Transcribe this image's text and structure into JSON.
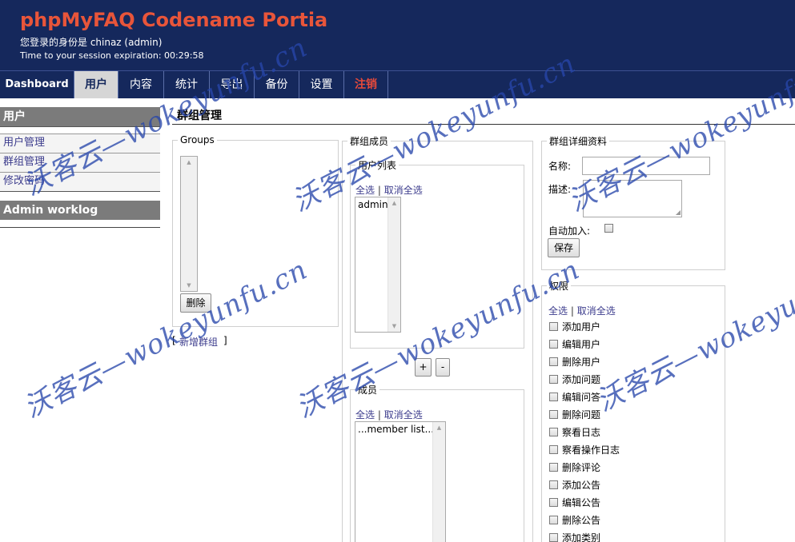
{
  "header": {
    "app_title": "phpMyFAQ Codename Portia",
    "login_line": "您登录的身份是 chinaz (admin)",
    "session_line": "Time to your session expiration: 00:29:58"
  },
  "nav": {
    "items": [
      "Dashboard",
      "用户",
      "内容",
      "统计",
      "导出",
      "备份",
      "设置",
      "注销"
    ],
    "active": "用户"
  },
  "sidebar": {
    "section_users": "用户",
    "items": [
      "用户管理",
      "群组管理",
      "修改密码"
    ],
    "section_worklog": "Admin worklog"
  },
  "main": {
    "page_title": "群组管理",
    "groups": {
      "legend": "Groups",
      "delete_button": "删除",
      "add_group_link": "新增群组",
      "bracket_open": "[",
      "bracket_close": "]"
    },
    "members": {
      "legend": "群组成员",
      "user_list_legend": "用户列表",
      "select_all": "全选",
      "deselect_all": "取消全选",
      "separator": "|",
      "user_list": [
        "admin"
      ],
      "add_button": "+",
      "remove_button": "-",
      "members_legend": "成员",
      "members_list": [
        "...member list..."
      ]
    },
    "details": {
      "legend": "群组详细资料",
      "name_label": "名称:",
      "description_label": "描述:",
      "auto_join_label": "自动加入:",
      "save_button": "保存"
    },
    "permissions": {
      "legend": "权限",
      "select_all": "全选",
      "deselect_all": "取消全选",
      "separator": "|",
      "items": [
        "添加用户",
        "编辑用户",
        "删除用户",
        "添加问题",
        "编辑问答",
        "删除问题",
        "察看日志",
        "察看操作日志",
        "删除评论",
        "添加公告",
        "编辑公告",
        "删除公告",
        "添加类别"
      ]
    }
  },
  "watermark": {
    "text": "沃客云—wokeyunfu.cn"
  },
  "colors": {
    "header_bg": "#15285c",
    "title_orange": "#e8553a",
    "logout_red": "#e84a3a",
    "link_blue": "#3b3b8c",
    "sidebar_head_gray": "#7b7b7b"
  }
}
